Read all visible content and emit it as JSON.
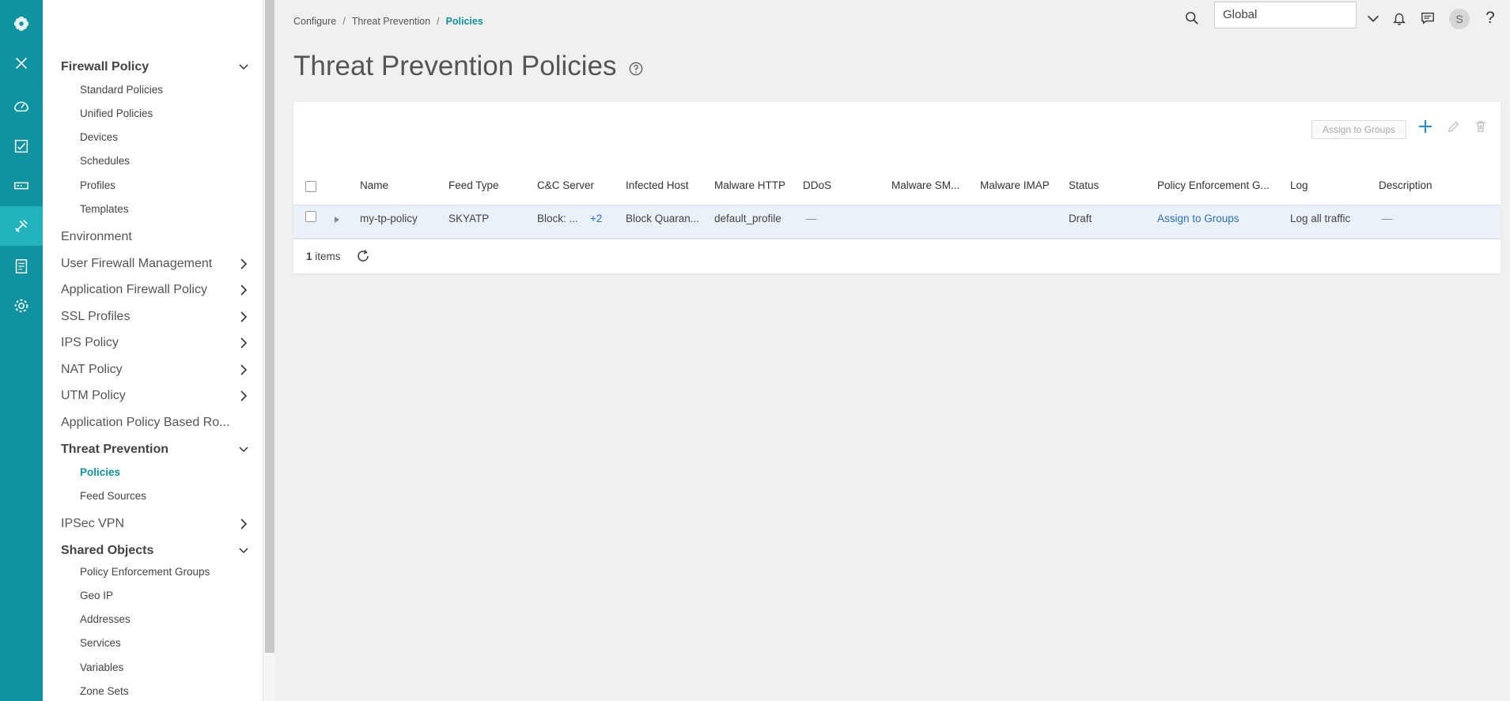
{
  "breadcrumb": {
    "items": [
      "Configure",
      "Threat Prevention"
    ],
    "current": "Policies",
    "separator": "/"
  },
  "topbar": {
    "domain_value": "Global",
    "avatar_initial": "S",
    "icons": [
      "search-icon",
      "chevron-down-icon",
      "bell-icon",
      "chat-icon",
      "help-icon"
    ]
  },
  "rail": {
    "icons": [
      "logo-flower-icon",
      "close-icon",
      "dashboard-gauge-icon",
      "monitor-chart-icon",
      "devices-icon",
      "configure-tools-icon",
      "reports-icon",
      "settings-gear-icon"
    ],
    "active": "configure-tools-icon",
    "colors": {
      "rail_bg": "#0f93a0",
      "rail_active": "#22b3bf"
    }
  },
  "nav": {
    "sections": [
      {
        "label": "Firewall Policy",
        "bold": true,
        "expanded": true,
        "items": [
          "Standard Policies",
          "Unified Policies",
          "Devices",
          "Schedules",
          "Profiles",
          "Templates"
        ]
      },
      {
        "label": "Environment",
        "bold": false
      },
      {
        "label": "User Firewall Management",
        "bold": false,
        "collapsed": true
      },
      {
        "label": "Application Firewall Policy",
        "bold": false,
        "collapsed": true
      },
      {
        "label": "SSL Profiles",
        "bold": false,
        "collapsed": true
      },
      {
        "label": "IPS Policy",
        "bold": false,
        "collapsed": true
      },
      {
        "label": "NAT Policy",
        "bold": false,
        "collapsed": true
      },
      {
        "label": "UTM Policy",
        "bold": false,
        "collapsed": true
      },
      {
        "label": "Application Policy Based Ro...",
        "bold": false
      },
      {
        "label": "Threat Prevention",
        "bold": true,
        "expanded": true,
        "items": [
          "Policies",
          "Feed Sources"
        ],
        "active_item": "Policies"
      },
      {
        "label": "IPSec VPN",
        "bold": false,
        "collapsed": true
      },
      {
        "label": "Shared Objects",
        "bold": true,
        "expanded": true,
        "items": [
          "Policy Enforcement Groups",
          "Geo IP",
          "Addresses",
          "Services",
          "Variables",
          "Zone Sets"
        ]
      }
    ]
  },
  "page": {
    "title": "Threat Prevention Policies"
  },
  "grid": {
    "toolbar": {
      "assign_label": "Assign to Groups",
      "icons": [
        "add-icon",
        "edit-icon",
        "delete-icon"
      ]
    },
    "columns": [
      "Name",
      "Feed Type",
      "C&C Server",
      "Infected Host",
      "Malware HTTP",
      "DDoS",
      "Malware SM...",
      "Malware IMAP",
      "Status",
      "Policy Enforcement G...",
      "Log",
      "Description"
    ],
    "rows": [
      {
        "name": "my-tp-policy",
        "feed_type": "SKYATP",
        "cc_server": "Block: ...",
        "cc_server_more": "+2",
        "infected_host": "Block Quaran...",
        "malware_http": "default_profile",
        "ddos": "—",
        "malware_smtp": "",
        "malware_imap": "",
        "status": "Draft",
        "policy_enforcement": "Assign to Groups",
        "log": "Log all traffic",
        "description": "—"
      }
    ],
    "footer": {
      "count": "1",
      "count_label": "items"
    },
    "colors": {
      "row_selected": "#eaf1f9",
      "link": "#2a6fbf",
      "accent": "#0f93a0"
    }
  }
}
